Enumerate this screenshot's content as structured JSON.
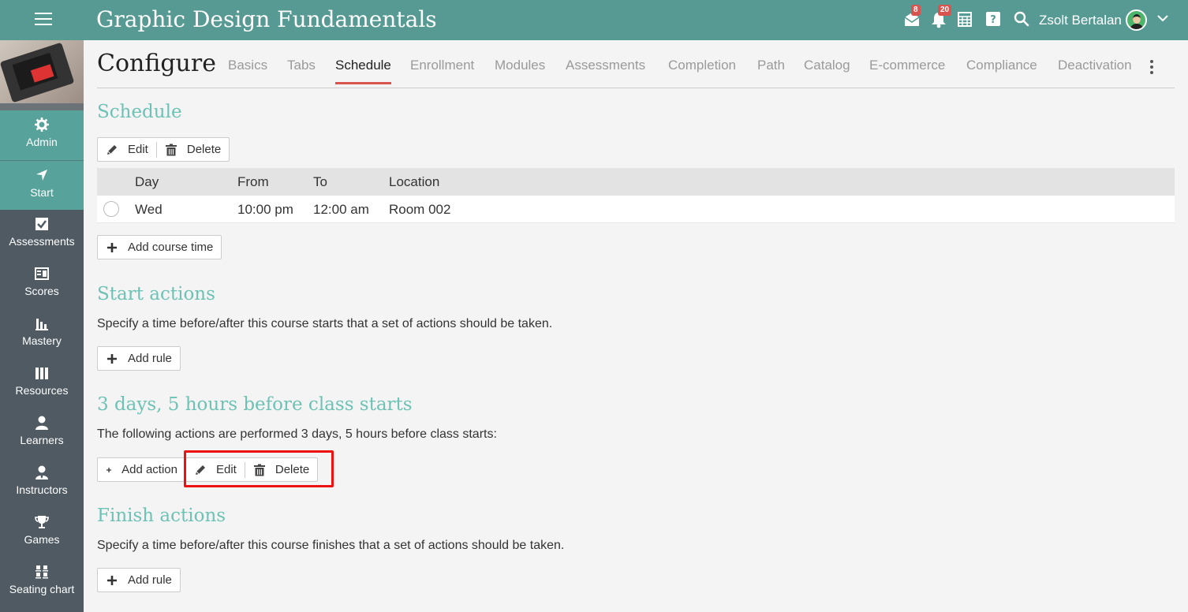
{
  "header": {
    "app_title": "Graphic Design Fundamentals",
    "messages_badge": "8",
    "notifications_badge": "20",
    "user_name": "Zsolt Bertalan"
  },
  "sidebar": {
    "items": [
      {
        "label": "Admin",
        "icon": "gear-icon"
      },
      {
        "label": "Start",
        "icon": "navigation-arrow-icon"
      },
      {
        "label": "Assessments",
        "icon": "checkbox-icon"
      },
      {
        "label": "Scores",
        "icon": "gradebook-icon"
      },
      {
        "label": "Mastery",
        "icon": "bar-chart-icon"
      },
      {
        "label": "Resources",
        "icon": "books-icon"
      },
      {
        "label": "Learners",
        "icon": "person-icon"
      },
      {
        "label": "Instructors",
        "icon": "instructor-icon"
      },
      {
        "label": "Games",
        "icon": "trophy-icon"
      },
      {
        "label": "Seating chart",
        "icon": "seating-icon"
      }
    ],
    "active_index": 1
  },
  "page": {
    "title": "Configure",
    "tabs": [
      "Basics",
      "Tabs",
      "Schedule",
      "Enrollment",
      "Modules",
      "Assessments",
      "Completion",
      "Path",
      "Catalog",
      "E-commerce",
      "Compliance",
      "Deactivation"
    ],
    "active_tab": "Schedule"
  },
  "schedule": {
    "title": "Schedule",
    "edit_label": "Edit",
    "delete_label": "Delete",
    "columns": [
      "Day",
      "From",
      "To",
      "Location"
    ],
    "rows": [
      {
        "day": "Wed",
        "from": "10:00 pm",
        "to": "12:00 am",
        "location": "Room 002"
      }
    ],
    "add_course_time_label": "Add course time"
  },
  "start_actions": {
    "title": "Start actions",
    "description": "Specify a time before/after this course starts that a set of actions should be taken.",
    "add_rule_label": "Add rule"
  },
  "rule": {
    "title": "3 days, 5 hours before class starts",
    "description": "The following actions are performed 3 days, 5 hours before class starts:",
    "add_action_label": "Add action",
    "edit_label": "Edit",
    "delete_label": "Delete"
  },
  "finish_actions": {
    "title": "Finish actions",
    "description": "Specify a time before/after this course finishes that a set of actions should be taken.",
    "add_rule_label": "Add rule"
  },
  "colors": {
    "header_bg": "#579a93",
    "sidebar_bg": "#4f5a62",
    "section_title": "#6dc2b5",
    "tab_underline": "#d9534f",
    "highlight": "#ee1111"
  }
}
